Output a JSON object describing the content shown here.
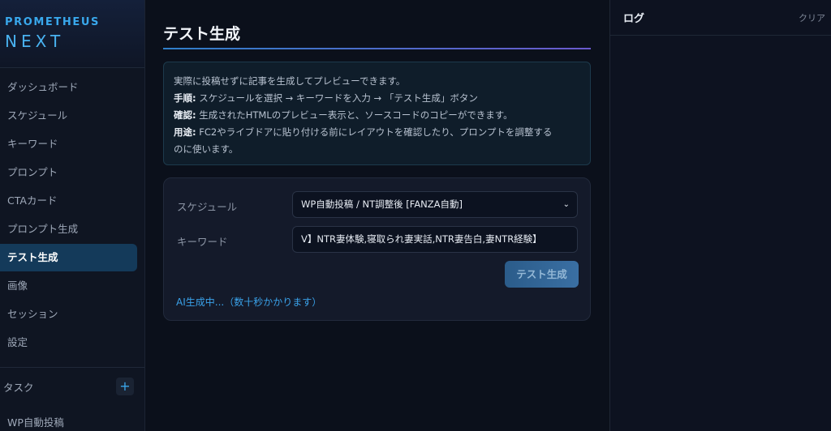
{
  "brand": {
    "line1": "PROMETHEUS",
    "line2": "NEXT"
  },
  "sidebar": {
    "items": [
      {
        "label": "ダッシュボード"
      },
      {
        "label": "スケジュール"
      },
      {
        "label": "キーワード"
      },
      {
        "label": "プロンプト"
      },
      {
        "label": "CTAカード"
      },
      {
        "label": "プロンプト生成"
      },
      {
        "label": "テスト生成"
      },
      {
        "label": "画像"
      },
      {
        "label": "セッション"
      },
      {
        "label": "設定"
      }
    ],
    "active_index": 6,
    "tasks_header": "タスク",
    "add_icon": "+",
    "task_items": [
      {
        "label": "WP自動投稿"
      }
    ]
  },
  "main": {
    "title": "テスト生成",
    "info": {
      "line1": "実際に投稿せずに記事を生成してプレビューできます。",
      "steps_label": "手順:",
      "steps_text": " スケジュールを選択 → キーワードを入力 → 「テスト生成」ボタン",
      "confirm_label": "確認:",
      "confirm_text": " 生成されたHTMLのプレビュー表示と、ソースコードのコピーができます。",
      "usage_label": "用途:",
      "usage_text_1": " FC2やライブドアに貼り付ける前にレイアウトを確認したり、プロンプトを調整する",
      "usage_text_2": "のに使います。"
    },
    "form": {
      "schedule_label": "スケジュール",
      "schedule_value": "WP自動投稿 / NT調整後 [FANZA自動]",
      "keyword_label": "キーワード",
      "keyword_value": "V】NTR妻体験,寝取られ妻実話,NTR妻告白,妻NTR経験】",
      "generate_button": "テスト生成",
      "status_text": "AI生成中...（数十秒かかります）"
    }
  },
  "log": {
    "title": "ログ",
    "clear_label": "クリア"
  },
  "colors": {
    "accent": "#3aa2ea",
    "active_bg": "#143a5a",
    "background": "#0b101b"
  }
}
